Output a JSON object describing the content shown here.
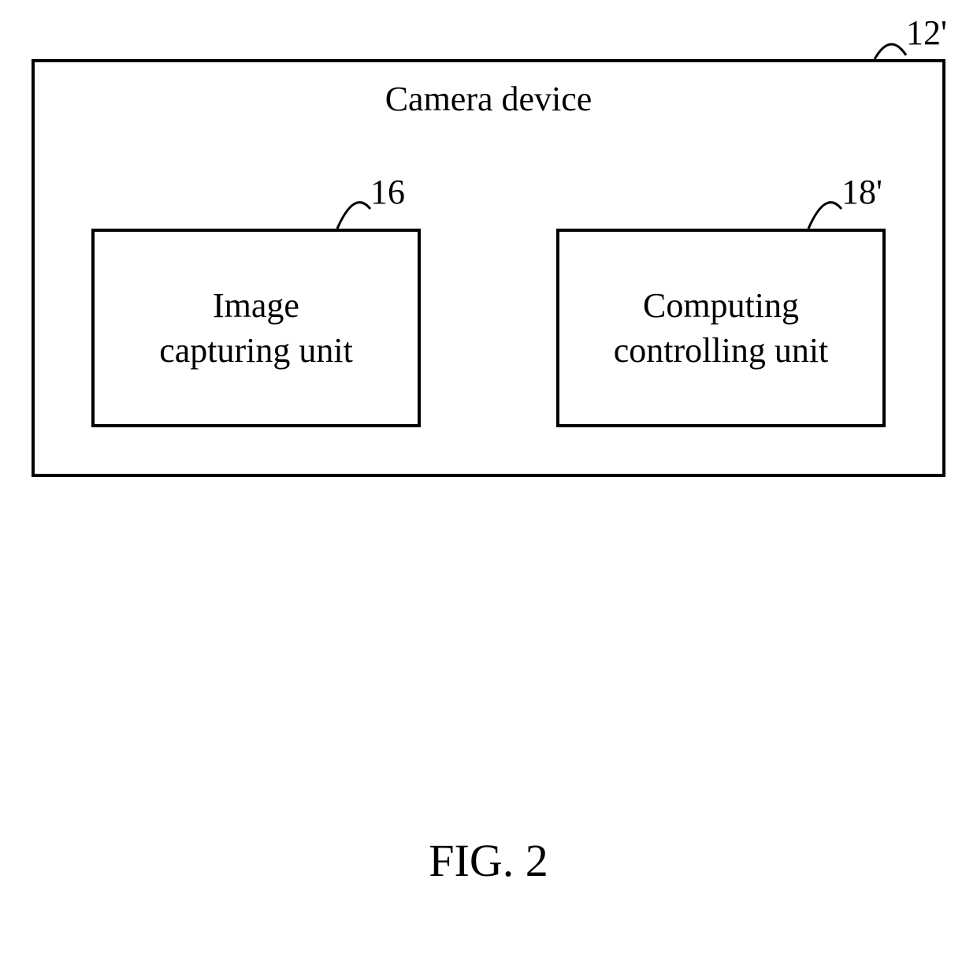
{
  "diagram": {
    "outerBox": {
      "title": "Camera device",
      "refLabel": "12'"
    },
    "innerLeft": {
      "line1": "Image",
      "line2": "capturing unit",
      "refLabel": "16"
    },
    "innerRight": {
      "line1": "Computing",
      "line2": "controlling unit",
      "refLabel": "18'"
    },
    "figureCaption": "FIG. 2"
  }
}
